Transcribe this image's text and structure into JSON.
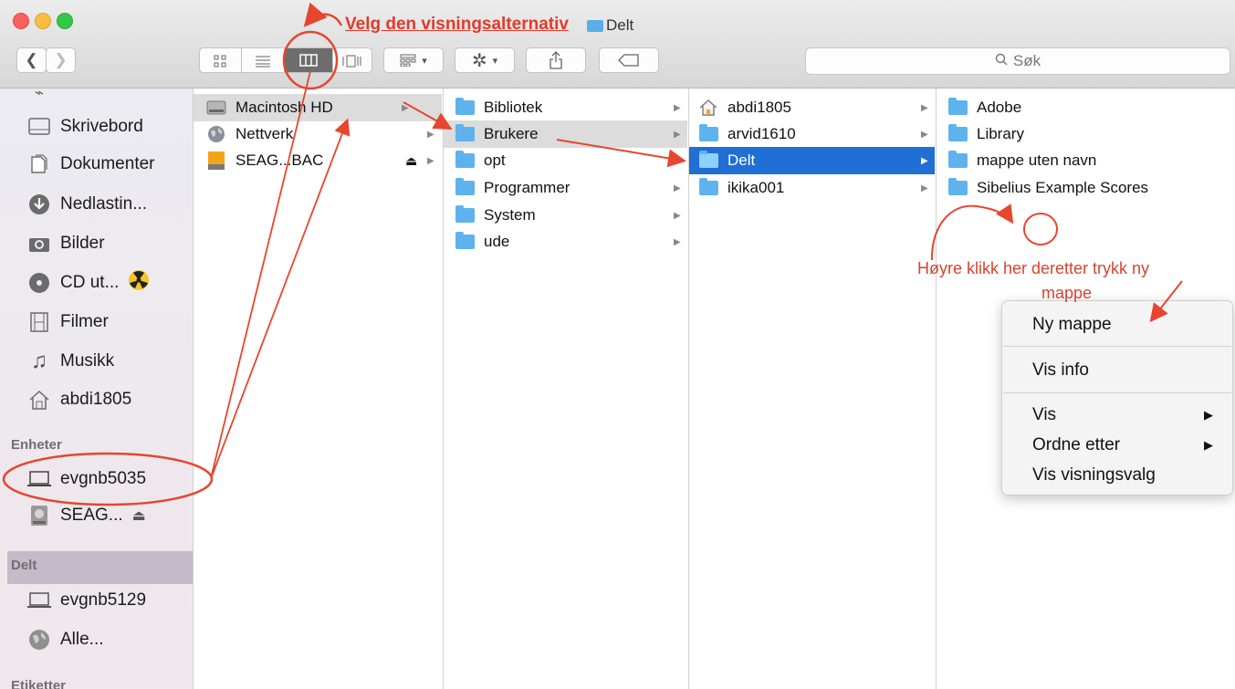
{
  "window": {
    "title": "Delt"
  },
  "toolbar": {
    "back_icon": "chevron-left-icon",
    "forward_icon": "chevron-right-icon",
    "view_icons": "icon-grid-icon",
    "view_list": "list-view-icon",
    "view_columns": "column-view-icon",
    "view_coverflow": "coverflow-view-icon",
    "search_placeholder": "Søk"
  },
  "sidebar": {
    "favorites": [
      {
        "label": "Skrivebord",
        "icon": "desktop-icon"
      },
      {
        "label": "Dokumenter",
        "icon": "documents-icon"
      },
      {
        "label": "Nedlastin...",
        "icon": "downloads-icon"
      },
      {
        "label": "Bilder",
        "icon": "camera-icon"
      },
      {
        "label": "CD ut...",
        "icon": "disc-icon"
      },
      {
        "label": "Filmer",
        "icon": "film-icon"
      },
      {
        "label": "Musikk",
        "icon": "music-note-icon"
      },
      {
        "label": "abdi1805",
        "icon": "home-icon"
      }
    ],
    "devices_heading": "Enheter",
    "devices": [
      {
        "label": "evgnb5035",
        "icon": "laptop-icon"
      },
      {
        "label": "SEAG...",
        "icon": "external-drive-icon"
      }
    ],
    "shared_heading": "Delt",
    "shared": [
      {
        "label": "evgnb5129",
        "icon": "laptop-icon"
      },
      {
        "label": "Alle...",
        "icon": "globe-icon"
      }
    ],
    "tags_heading": "Etiketter"
  },
  "columns": [
    {
      "items": [
        {
          "label": "Macintosh HD",
          "icon": "hard-drive-icon",
          "selected": true
        },
        {
          "label": "Nettverk",
          "icon": "network-globe-icon"
        },
        {
          "label": "SEAG...BAC",
          "icon": "external-drive-icon",
          "eject": true
        }
      ]
    },
    {
      "items": [
        {
          "label": "Bibliotek",
          "icon": "library-folder-icon"
        },
        {
          "label": "Brukere",
          "icon": "users-folder-icon",
          "selected": true
        },
        {
          "label": "opt",
          "icon": "folder-icon"
        },
        {
          "label": "Programmer",
          "icon": "applications-folder-icon"
        },
        {
          "label": "System",
          "icon": "system-folder-icon"
        },
        {
          "label": "ude",
          "icon": "folder-icon"
        }
      ]
    },
    {
      "items": [
        {
          "label": "abdi1805",
          "icon": "home-icon"
        },
        {
          "label": "arvid1610",
          "icon": "folder-icon"
        },
        {
          "label": "Delt",
          "icon": "folder-icon",
          "active": true
        },
        {
          "label": "ikika001",
          "icon": "folder-icon"
        }
      ]
    },
    {
      "items": [
        {
          "label": "Adobe",
          "icon": "folder-icon"
        },
        {
          "label": "Library",
          "icon": "folder-icon"
        },
        {
          "label": "mappe uten navn",
          "icon": "folder-icon"
        },
        {
          "label": "Sibelius Example Scores",
          "icon": "folder-icon"
        }
      ]
    }
  ],
  "context_menu": {
    "new_folder": "Ny mappe",
    "get_info": "Vis info",
    "view": "Vis",
    "arrange_by": "Ordne etter",
    "view_options": "Vis visningsvalg"
  },
  "annotations": {
    "top": "Velg den visningsalternativ",
    "right_line1": "Høyre klikk her deretter trykk  ny",
    "right_line2": "mappe"
  },
  "colors": {
    "selection_blue": "#1f6fd5",
    "annotation_red": "#e23a2a"
  }
}
